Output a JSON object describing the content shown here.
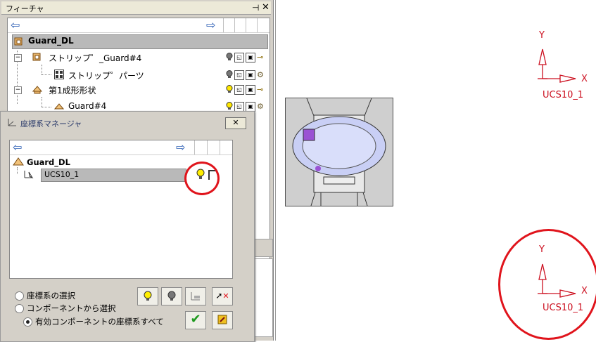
{
  "feature_panel": {
    "title": "フィーチャ",
    "pin_icon": "pin-icon",
    "close_icon": "close-icon",
    "root": "Guard_DL",
    "items": [
      {
        "label": "ストリップ゜_Guard#4"
      },
      {
        "label": "ストリップ゜パーツ"
      },
      {
        "label": "第1成形形状"
      },
      {
        "label": "Guard#4"
      }
    ]
  },
  "csm_dialog": {
    "title": "座標系マネージャ",
    "close_label": "✕",
    "root": "Guard_DL",
    "ucs_item": "UCS10_1",
    "radio_options": [
      {
        "label": "座標系の選択",
        "selected": false
      },
      {
        "label": "コンポーネントから選択",
        "selected": false
      },
      {
        "label": "有効コンポーネントの座標系すべて",
        "selected": true
      }
    ]
  },
  "viewport": {
    "ucs_top": {
      "y_label": "Y",
      "x_label": "X",
      "name": "UCS10_1"
    },
    "ucs_bottom": {
      "y_label": "Y",
      "x_label": "X",
      "name": "UCS10_1"
    }
  },
  "colors": {
    "highlight": "#e0141c",
    "axis": "#cc1020",
    "tree_select": "#b9b9b9"
  }
}
